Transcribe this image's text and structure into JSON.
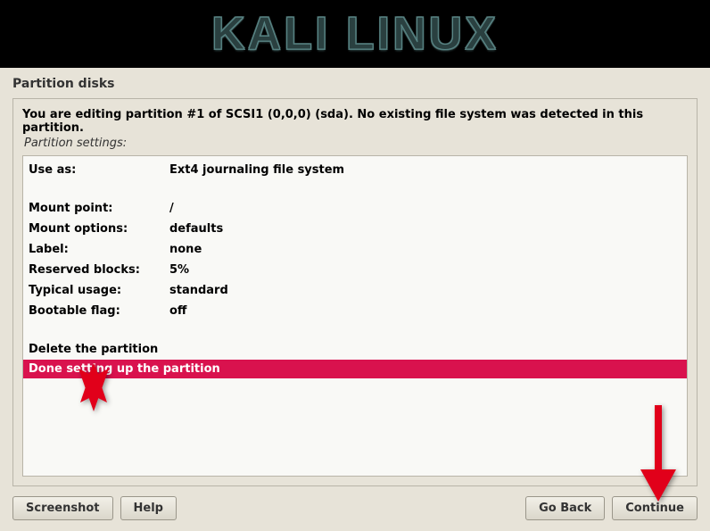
{
  "header": {
    "logo_text": "KALI LINUX"
  },
  "page": {
    "title": "Partition disks",
    "instruction": "You are editing partition #1 of SCSI1 (0,0,0) (sda). No existing file system was detected in this partition.",
    "subtitle": "Partition settings:"
  },
  "settings": [
    {
      "label": "Use as:",
      "value": "Ext4 journaling file system"
    }
  ],
  "settings2": [
    {
      "label": "Mount point:",
      "value": "/"
    },
    {
      "label": "Mount options:",
      "value": "defaults"
    },
    {
      "label": "Label:",
      "value": "none"
    },
    {
      "label": "Reserved blocks:",
      "value": "5%"
    },
    {
      "label": "Typical usage:",
      "value": "standard"
    },
    {
      "label": "Bootable flag:",
      "value": "off"
    }
  ],
  "actions": {
    "delete": "Delete the partition",
    "done": "Done setting up the partition"
  },
  "buttons": {
    "screenshot": "Screenshot",
    "help": "Help",
    "goback": "Go Back",
    "continue": "Continue"
  }
}
